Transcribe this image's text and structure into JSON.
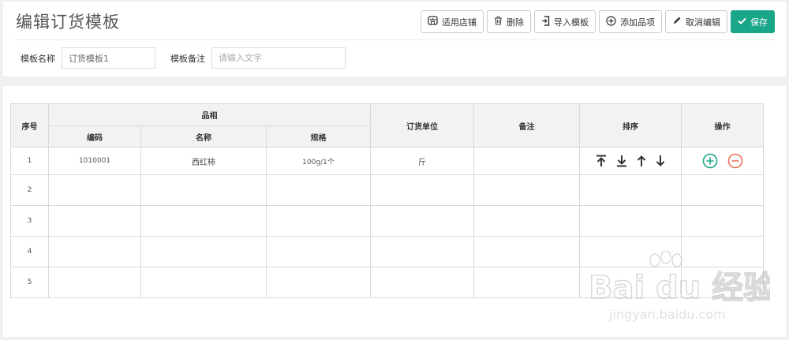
{
  "header": {
    "title": "编辑订货模板",
    "toolbar": {
      "apply_store": "适用店铺",
      "delete": "删除",
      "import": "导入模板",
      "add_item": "添加品项",
      "cancel_edit": "取消编辑",
      "save": "保存"
    }
  },
  "form": {
    "name_label": "模板名称",
    "name_value": "订货模板1",
    "remark_label": "模板备注",
    "remark_placeholder": "请输入文字"
  },
  "table": {
    "headers": {
      "index": "序号",
      "item_group": "品相",
      "code": "编码",
      "name": "名称",
      "spec": "规格",
      "unit": "订货单位",
      "remark": "备注",
      "sort": "排序",
      "action": "操作"
    },
    "rows": [
      {
        "index": "1",
        "code": "1010001",
        "name": "西红柿",
        "spec": "100g/1个",
        "unit": "斤",
        "remark": ""
      },
      {
        "index": "2",
        "code": "",
        "name": "",
        "spec": "",
        "unit": "",
        "remark": ""
      },
      {
        "index": "3",
        "code": "",
        "name": "",
        "spec": "",
        "unit": "",
        "remark": ""
      },
      {
        "index": "4",
        "code": "",
        "name": "",
        "spec": "",
        "unit": "",
        "remark": ""
      },
      {
        "index": "5",
        "code": "",
        "name": "",
        "spec": "",
        "unit": "",
        "remark": ""
      }
    ]
  },
  "icons": {
    "store": "store-icon",
    "trash": "trash-icon",
    "import": "import-icon",
    "plus_circle": "plus-circle-icon",
    "pencil": "pencil-icon",
    "check": "check-icon",
    "move_top": "move-top-icon",
    "move_bottom": "move-bottom-icon",
    "move_up": "move-up-icon",
    "move_down": "move-down-icon",
    "add_row": "add-row-icon",
    "remove_row": "remove-row-icon"
  },
  "colors": {
    "accent": "#1aa689",
    "add": "#1aa689",
    "remove": "#e8705a"
  },
  "watermark": {
    "brand": "Bai du 经验",
    "url": "jingyan.baidu.com"
  }
}
